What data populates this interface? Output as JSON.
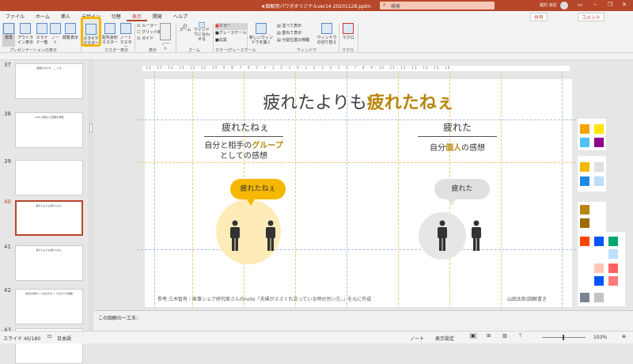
{
  "titlebar": {
    "filename": "★図解用パワポオリジナルver14 20201128.pptm",
    "search": "検索",
    "user": "堀村 京紀"
  },
  "tabs": [
    "ファイル",
    "ホーム",
    "挿入",
    "デザイン",
    "切替",
    "表示",
    "開発",
    "ヘルプ"
  ],
  "active_tab": "表示",
  "share": "共有",
  "comment": "コメント",
  "ribbon": {
    "buttons": [
      "標準",
      "アウトライン表示",
      "スライド一覧",
      "ノート",
      "閲覧表示",
      "スライドマスター",
      "配布資料マスター",
      "ノートマスター",
      "ノート",
      "ズーム",
      "ウィンドウに合わせる",
      "新しいウィンドウを開く",
      "ウィンドウの切り替え",
      "マクロ"
    ],
    "checks": [
      {
        "label": "ルーラー",
        "checked": true
      },
      {
        "label": "グリッド線",
        "checked": false
      },
      {
        "label": "ガイド",
        "checked": true
      }
    ],
    "color": [
      "カラー",
      "グレースケール",
      "白黒"
    ],
    "window": [
      "並べて表示",
      "重ねて表示",
      "分割位置の移動"
    ],
    "groups": [
      "プレゼンテーションの表示",
      "マスター表示",
      "表示",
      "ズーム",
      "カラー/グレースケール",
      "ウィンドウ",
      "マクロ"
    ],
    "highlight_color": "#f5b700"
  },
  "thumbnails": [
    {
      "num": "37",
      "title": "図解のかけ方：___とき"
    },
    {
      "num": "38",
      "title": "noteに投稿した図解の枚数"
    },
    {
      "num": "39",
      "title": ""
    },
    {
      "num": "40",
      "title": "疲れたよりも疲れたねぇ",
      "selected": true
    },
    {
      "num": "41",
      "title": "疲れたよりも疲れたねぇ"
    },
    {
      "num": "42",
      "title": "過去の意味 × 今日の気付 = 今日だけの価値"
    },
    {
      "num": "43",
      "title": "過去の意味も、今日の気付もどちらも大事"
    }
  ],
  "ruler": "· 16 · 15 · 14 · 13 · 12 · 11 · 10 · 9 · 8 · 7 · 6 · 5 · 4 · 3 · 2 · 1 · 0 · 1 · 2 · 3 · 4 · 5 · 6 · 7 · 8 · 9 · 10 · 11 · 12 · 13 · 14 · 15 · 16 ·",
  "slide": {
    "title_a": "疲れたよりも",
    "title_b": "疲れたねぇ",
    "left": {
      "heading": "疲れたねぇ",
      "line1_a": "自分と相手の",
      "line1_b": "グループ",
      "line2": "としての感想",
      "bubble": "疲れたねぇ"
    },
    "right": {
      "heading": "疲れた",
      "line1_a": "自分",
      "line1_b": "個人",
      "line1_c": "の感想",
      "bubble": "疲れた"
    },
    "footer": "参考:三木智有｜家事シェア研究家さんのnote「夫婦がささくれ立っている時の労い方。」を元に作成",
    "credit": "山田太郎|図解書き"
  },
  "palette": [
    "#f5a300",
    "#ffe600",
    "#4fc3f7",
    "#8b008b",
    "#f5b700",
    "#e0e0e0",
    "#1e88e5",
    "#bbdefb",
    "#b8860b",
    "#a06a00",
    "#ff4500",
    "#0055ff",
    "#00a86b",
    "#bde0ff",
    "#ffc7b8",
    "#ff6060",
    "#0055ff",
    "#ff7a7a",
    "#7a8390",
    "#c4c4c4"
  ],
  "notes_placeholder": "この図解の一工夫：",
  "status": {
    "slide": "スライド 40/180",
    "lang": "日本語",
    "notes": "ノート",
    "display": "表示設定",
    "zoom": "103%"
  }
}
